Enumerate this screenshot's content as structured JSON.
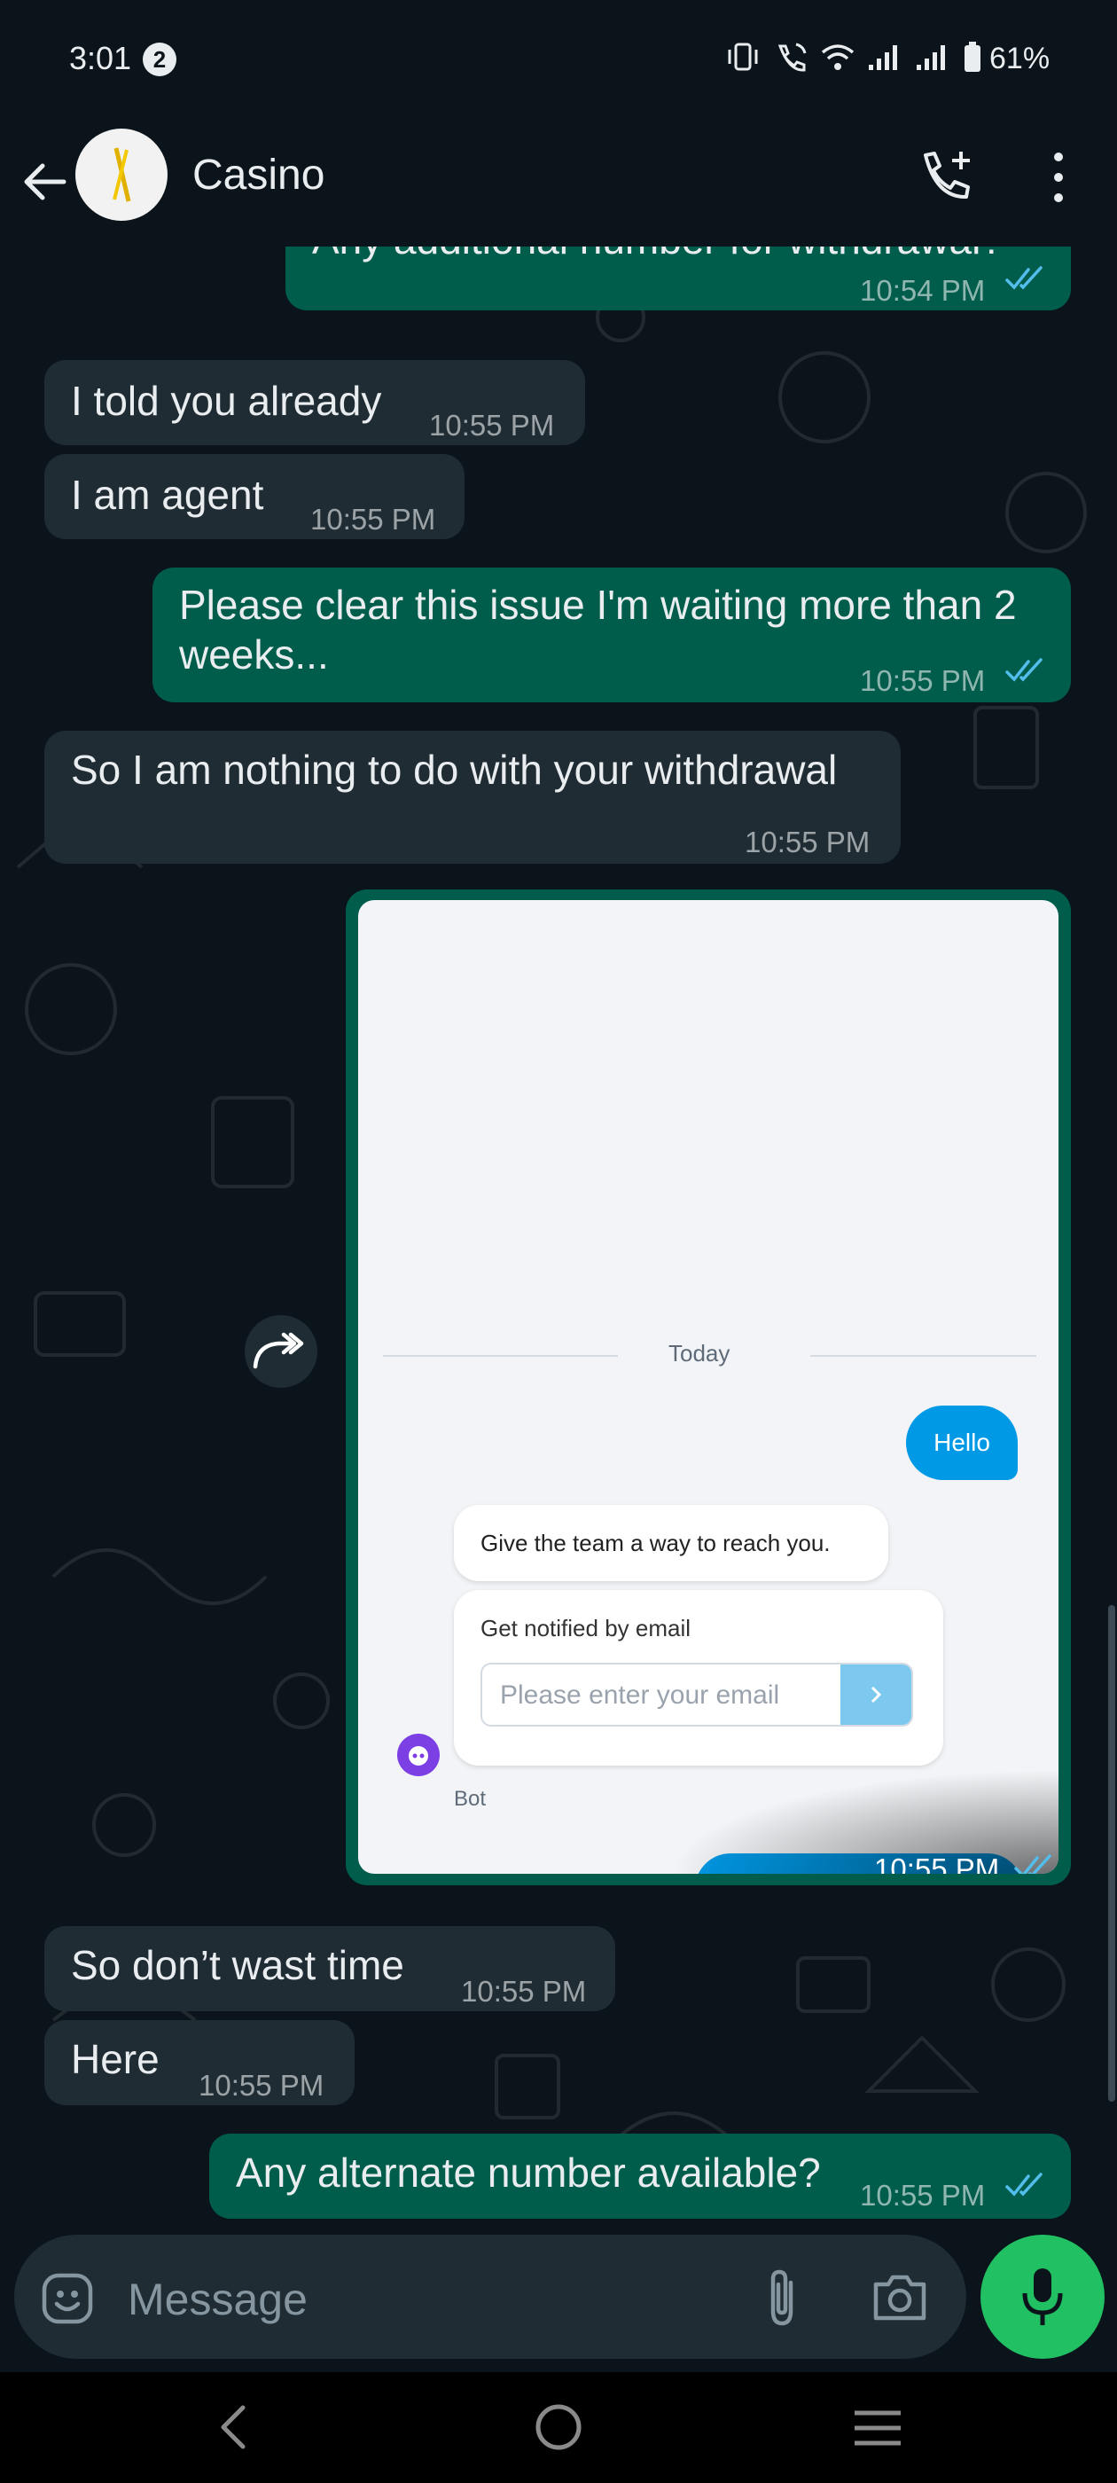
{
  "status_bar": {
    "time": "3:01",
    "notification_count": "2",
    "battery": "61%"
  },
  "header": {
    "contact_name": "Casino",
    "back_icon": "arrow-left-icon",
    "call_icon": "add-call-icon",
    "menu_icon": "more-vert-icon"
  },
  "messages": [
    {
      "direction": "out",
      "text": "Any additional number for withdrawal?",
      "time": "10:54 PM",
      "status": "read"
    },
    {
      "direction": "in",
      "text": "I told you already",
      "time": "10:55 PM"
    },
    {
      "direction": "in",
      "text": "I am agent",
      "time": "10:55 PM"
    },
    {
      "direction": "out",
      "text": "Please clear this issue I'm waiting more than 2 weeks...",
      "time": "10:55 PM",
      "status": "read"
    },
    {
      "direction": "in",
      "text": "So I am nothing to do with your withdrawal",
      "time": "10:55 PM"
    },
    {
      "direction": "out",
      "type": "image",
      "time": "10:55 PM",
      "status": "read"
    },
    {
      "direction": "in",
      "text": "So don’t wast time",
      "time": "10:55 PM"
    },
    {
      "direction": "in",
      "text": "Here",
      "time": "10:55 PM"
    },
    {
      "direction": "out",
      "text": "Any alternate number available?",
      "time": "10:55 PM",
      "status": "read"
    }
  ],
  "screenshot_image": {
    "divider_label": "Today",
    "hello_text": "Hello",
    "prompt_text": "Give the team a way to reach you.",
    "email_card_title": "Get notified by email",
    "email_placeholder": "Please enter your email",
    "bot_label": "Bot"
  },
  "input_bar": {
    "placeholder": "Message",
    "emoji_icon": "emoji-icon",
    "attach_icon": "paperclip-icon",
    "camera_icon": "camera-icon",
    "mic_icon": "mic-icon"
  },
  "colors": {
    "background": "#0b141a",
    "incoming": "#202c33",
    "outgoing": "#005c4b",
    "read_ticks": "#53bdeb",
    "mic_button": "#21c063"
  }
}
